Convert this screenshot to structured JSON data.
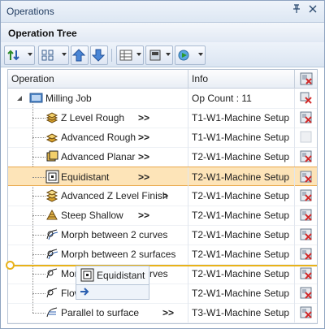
{
  "window": {
    "title": "Operations",
    "pin": "ꟷ",
    "close": "✕"
  },
  "panel": {
    "title": "Operation Tree"
  },
  "columns": {
    "operation": "Operation",
    "info": "Info"
  },
  "root": {
    "name": "Milling Job",
    "info": "Op Count : 11"
  },
  "rows": [
    {
      "name": "Z Level Rough",
      "arrows": ">>",
      "info": "T1-W1-Machine Setup",
      "icon": "z-level-rough-icon",
      "status": "red"
    },
    {
      "name": "Advanced Rough",
      "arrows": ">>",
      "info": "T1-W1-Machine Setup",
      "icon": "advanced-rough-icon",
      "status": "grey"
    },
    {
      "name": "Advanced Planar",
      "arrows": ">>",
      "info": "T2-W1-Machine Setup",
      "icon": "advanced-planar-icon",
      "status": "red"
    },
    {
      "name": "Equidistant",
      "arrows": ">>",
      "info": "T2-W1-Machine Setup",
      "icon": "equidistant-icon",
      "status": "red",
      "selected": true
    },
    {
      "name": "Advanced Z Level Finish",
      "arrows": ">",
      "info": "T2-W1-Machine Setup",
      "icon": "z-level-finish-icon",
      "status": "red"
    },
    {
      "name": "Steep Shallow",
      "arrows": ">>",
      "info": "T2-W1-Machine Setup",
      "icon": "steep-shallow-icon",
      "status": "red"
    },
    {
      "name": "Morph between 2 curves",
      "arrows": "",
      "info": "T2-W1-Machine Setup",
      "icon": "morph-curves-icon",
      "status": "red"
    },
    {
      "name": "Morph between 2 surfaces",
      "arrows": "",
      "info": "T2-W1-Machine Setup",
      "icon": "morph-surfaces-icon",
      "status": "red"
    },
    {
      "name": "Mor",
      "tail": "rves",
      "arrows": "",
      "info": "T2-W1-Machine Setup",
      "icon": "morph-icon",
      "status": "red"
    },
    {
      "name": "Flow",
      "arrows": "",
      "info": "T2-W1-Machine Setup",
      "icon": "flow-icon",
      "status": "red"
    },
    {
      "name": "Parallel to surface",
      "arrows": ">>",
      "info": "T3-W1-Machine Setup",
      "icon": "parallel-surface-icon",
      "status": "red"
    }
  ],
  "drag": {
    "label": "Equidistant"
  },
  "colors": {
    "selected": "#fde4b8",
    "dropline": "#e8b21a",
    "status_red": "#d22b2b"
  }
}
